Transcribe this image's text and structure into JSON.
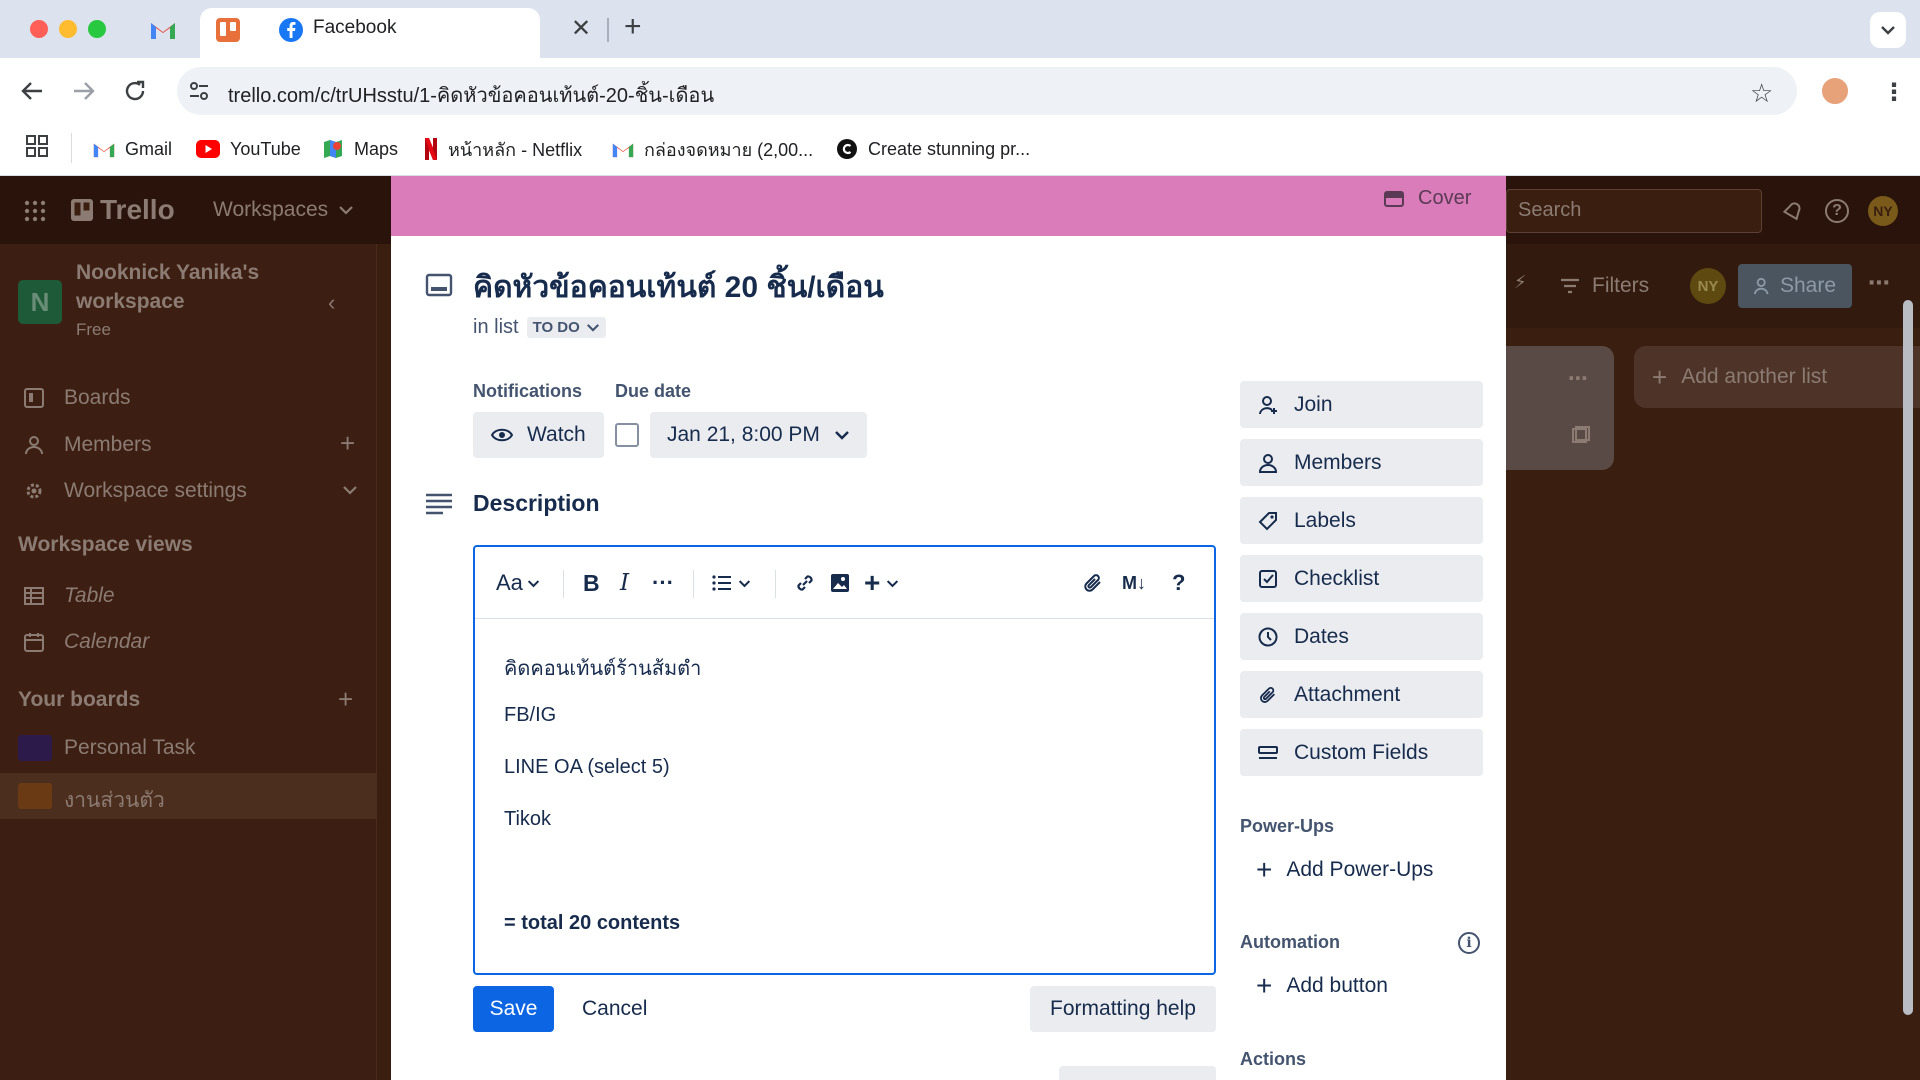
{
  "browser": {
    "tabs": [
      {
        "name": "gmail-tab"
      },
      {
        "name": "trello-tab",
        "active": true
      },
      {
        "name": "facebook-tab",
        "title": "Facebook"
      }
    ],
    "url": "trello.com/c/trUHsstu/1-คิดหัวข้อคอนเท้นต์-20-ชิ้น-เดือน",
    "bookmarks": [
      "Gmail",
      "YouTube",
      "Maps",
      "หน้าหลัก - Netflix",
      "กล่องจดหมาย (2,00...",
      "Create stunning pr..."
    ]
  },
  "trello": {
    "logo": "Trello",
    "workspaces": "Workspaces",
    "search_placeholder": "Search",
    "workspace": {
      "initial": "N",
      "name_line1": "Nooknick Yanika's",
      "name_line2": "workspace",
      "plan": "Free"
    },
    "sidebar": {
      "boards": "Boards",
      "members": "Members",
      "settings": "Workspace settings",
      "views_heading": "Workspace views",
      "table": "Table",
      "calendar": "Calendar",
      "your_boards": "Your boards",
      "boards_list": [
        "Personal Task",
        "งานส่วนตัว"
      ]
    },
    "board": {
      "filters": "Filters",
      "avatar": "NY",
      "share": "Share",
      "add_list": "Add another list"
    }
  },
  "card": {
    "cover_label": "Cover",
    "title": "คิดหัวข้อคอนเท้นต์ 20 ชิ้น/เดือน",
    "in_list_prefix": "in list",
    "list_name": "TO DO",
    "notifications_label": "Notifications",
    "watch": "Watch",
    "due_label": "Due date",
    "due_value": "Jan 21, 8:00 PM",
    "description_heading": "Description",
    "toolbar": {
      "text_style": "Aa",
      "markdown": "M↓",
      "help": "?"
    },
    "description_lines": [
      "คิดคอนเท้นต์ร้านส้มตำ",
      "FB/IG",
      "LINE OA (select 5)",
      "Tikok",
      "= total 20 contents"
    ],
    "save": "Save",
    "cancel": "Cancel",
    "formatting_help": "Formatting help",
    "side_buttons": [
      "Join",
      "Members",
      "Labels",
      "Checklist",
      "Dates",
      "Attachment",
      "Custom Fields"
    ],
    "powerups_heading": "Power-Ups",
    "add_powerups": "Add Power-Ups",
    "automation_heading": "Automation",
    "add_button": "Add button",
    "actions_heading": "Actions"
  },
  "colors": {
    "cover": "#d97cb9",
    "primary": "#0c66e4",
    "workspace_badge": "#1f7a4a"
  }
}
